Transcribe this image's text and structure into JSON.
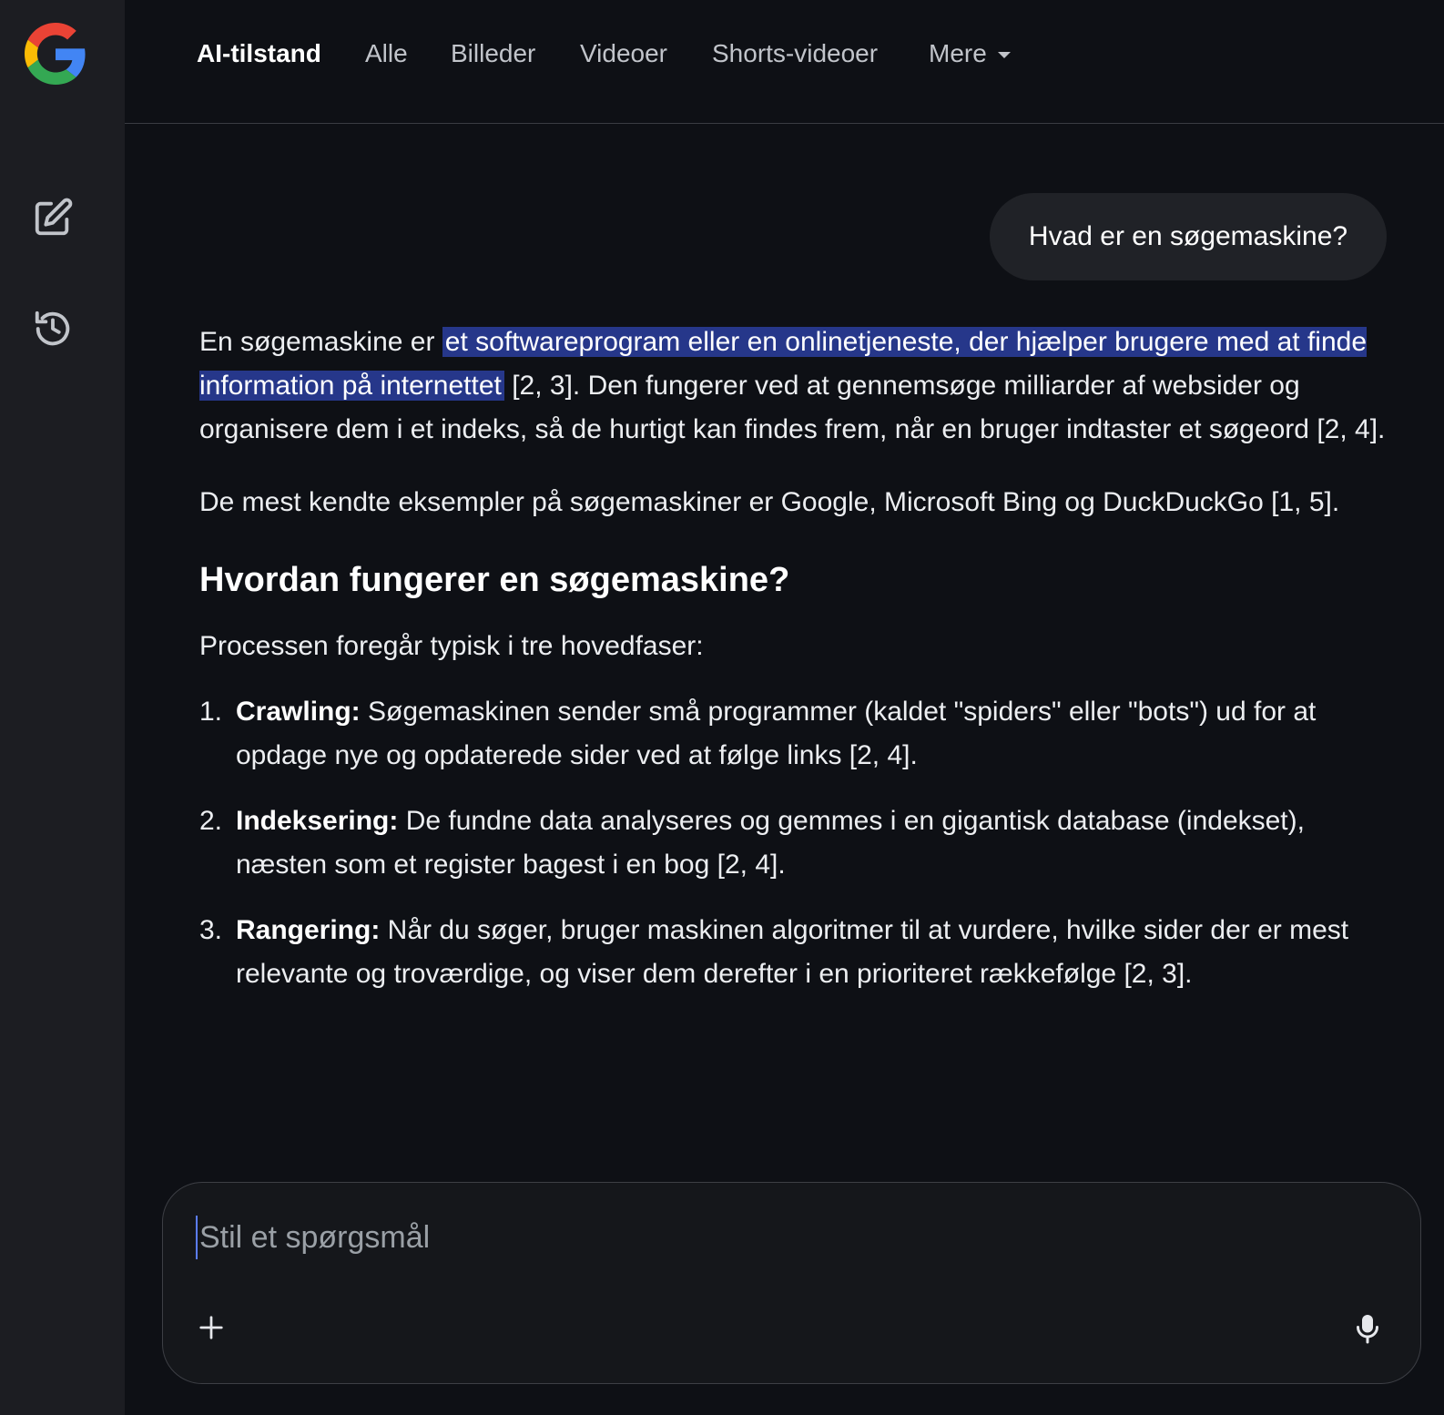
{
  "nav": {
    "tabs": [
      {
        "label": "AI-tilstand",
        "active": true
      },
      {
        "label": "Alle"
      },
      {
        "label": "Billeder"
      },
      {
        "label": "Videoer"
      },
      {
        "label": "Shorts-videoer"
      },
      {
        "label": "Mere"
      }
    ]
  },
  "sidebar": {
    "logo_icon": "google-g-logo",
    "new_chat_icon": "edit-icon",
    "history_icon": "history-icon"
  },
  "conversation": {
    "user_query": "Hvad er en søgemaskine?",
    "answer": {
      "p1_start": "En søgemaskine er ",
      "p1_highlight": "et softwareprogram eller en onlinetjeneste, der hjælper brugere med at finde information på internettet",
      "p1_end": " [2, 3]. Den fungerer ved at gennemsøge milliarder af websider og organisere dem i et indeks, så de hurtigt kan findes frem, når en bruger indtaster et søgeord [2, 4].",
      "p2": "De mest kendte eksempler på søgemaskiner er Google, Microsoft Bing og DuckDuckGo [1, 5].",
      "heading": "Hvordan fungerer en søgemaskine?",
      "p3": "Processen foregår typisk i tre hovedfaser:",
      "steps": [
        {
          "num": "1.",
          "term": "Crawling:",
          "text": " Søgemaskinen sender små programmer (kaldet \"spiders\" eller \"bots\") ud for at opdage nye og opdaterede sider ved at følge links [2, 4]."
        },
        {
          "num": "2.",
          "term": "Indeksering:",
          "text": " De fundne data analyseres og gemmes i en gigantisk database (indekset), næsten som et register bagest i en bog [2, 4]."
        },
        {
          "num": "3.",
          "term": "Rangering:",
          "text": " Når du søger, bruger maskinen algoritmer til at vurdere, hvilke sider der er mest relevante og troværdige, og viser dem derefter i en prioriteret rækkefølge [2, 3]."
        }
      ]
    }
  },
  "composer": {
    "placeholder": "Stil et spørgsmål",
    "value": "",
    "add_icon": "plus-icon",
    "mic_icon": "microphone-icon"
  },
  "colors": {
    "background": "#0e1015",
    "sidebar": "#1c1d22",
    "highlight": "#26378a",
    "bubble": "#202227"
  }
}
